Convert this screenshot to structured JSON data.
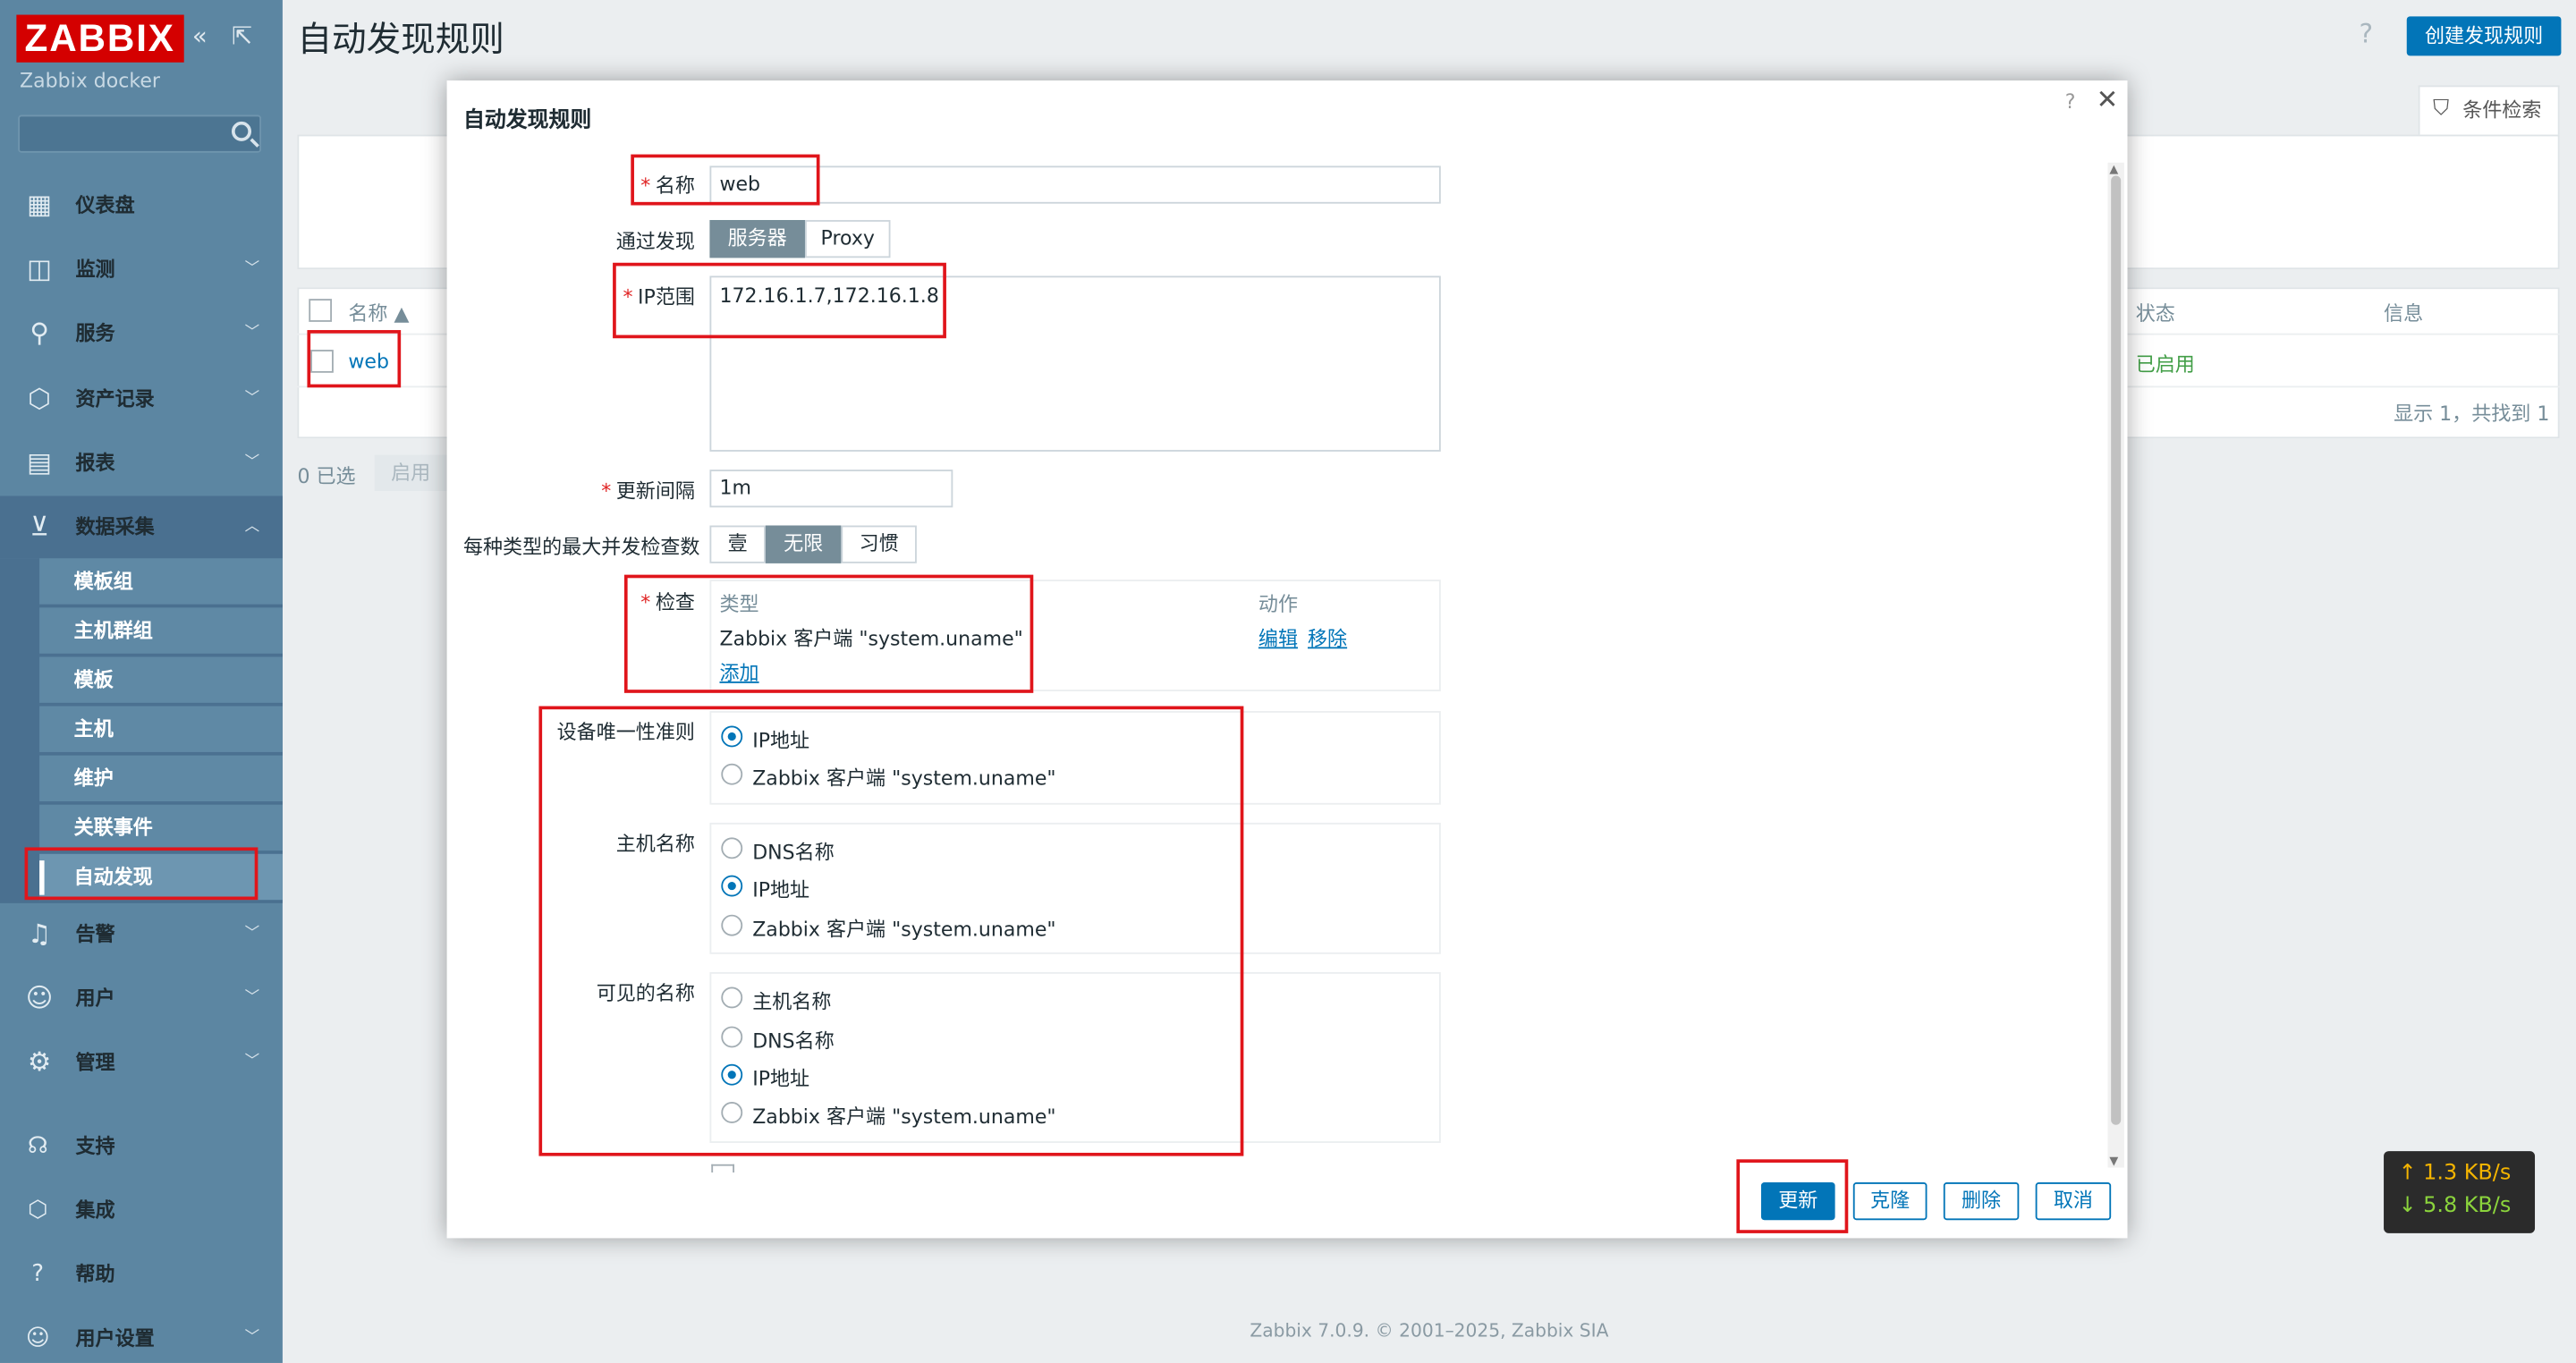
{
  "sidebar": {
    "logo": "ZABBIX",
    "collapse_icon": "«",
    "expand_icon": "⇱",
    "instance_name": "Zabbix docker",
    "search_placeholder": "",
    "menu": [
      {
        "label": "仪表盘",
        "icon": "dashboard-icon"
      },
      {
        "label": "监测",
        "icon": "monitoring-icon"
      },
      {
        "label": "服务",
        "icon": "services-icon"
      },
      {
        "label": "资产记录",
        "icon": "inventory-icon"
      },
      {
        "label": "报表",
        "icon": "reports-icon"
      },
      {
        "label": "数据采集",
        "icon": "data-collection-icon"
      }
    ],
    "submenu": [
      "模板组",
      "主机群组",
      "模板",
      "主机",
      "维护",
      "关联事件",
      "自动发现"
    ],
    "menu2": [
      {
        "label": "告警",
        "icon": "alerts-icon"
      },
      {
        "label": "用户",
        "icon": "users-icon"
      },
      {
        "label": "管理",
        "icon": "admin-icon"
      }
    ],
    "bottom": [
      {
        "label": "支持",
        "icon": "support-icon"
      },
      {
        "label": "集成",
        "icon": "integrations-icon"
      },
      {
        "label": "帮助",
        "icon": "help-icon"
      },
      {
        "label": "用户设置",
        "icon": "user-settings-icon"
      }
    ]
  },
  "header": {
    "title": "自动发现规则",
    "help": "?",
    "create_button": "创建发现规则",
    "filter_tab": "条件检索"
  },
  "table": {
    "col_name": "名称 ▲",
    "col_status": "状态",
    "col_info": "信息",
    "row_name": "web",
    "row_status": "已启用",
    "summary": "显示 1，共找到 1",
    "selected": "0 已选",
    "enable_button": "启用"
  },
  "modal": {
    "title": "自动发现规则",
    "help": "?",
    "close": "✕",
    "name_label": "名称",
    "name_value": "web",
    "discovery_by_label": "通过发现",
    "discovery_by_options": [
      "服务器",
      "Proxy"
    ],
    "ip_range_label": "IP范围",
    "ip_range_value": "172.16.1.7,172.16.1.8",
    "update_interval_label": "更新间隔",
    "update_interval_value": "1m",
    "max_checks_label": "每种类型的最大并发检查数",
    "max_checks_options": [
      "壹",
      "无限",
      "习惯"
    ],
    "checks_label": "检查",
    "checks_col_type": "类型",
    "checks_col_action": "动作",
    "check_row": "Zabbix 客户端 \"system.uname\"",
    "check_edit": "编辑",
    "check_remove": "移除",
    "check_add": "添加",
    "uniqueness_label": "设备唯一性准则",
    "uniqueness_options": [
      "IP地址",
      "Zabbix 客户端 \"system.uname\""
    ],
    "hostname_label": "主机名称",
    "hostname_options": [
      "DNS名称",
      "IP地址",
      "Zabbix 客户端 \"system.uname\""
    ],
    "visible_name_label": "可见的名称",
    "visible_name_options": [
      "主机名称",
      "DNS名称",
      "IP地址",
      "Zabbix 客户端 \"system.uname\""
    ],
    "buttons": {
      "update": "更新",
      "clone": "克隆",
      "delete": "删除",
      "cancel": "取消"
    }
  },
  "speed": {
    "up": "↑ 1.3 KB/s",
    "down": "↓ 5.8 KB/s"
  },
  "footer": "Zabbix 7.0.9. © 2001–2025, Zabbix SIA"
}
